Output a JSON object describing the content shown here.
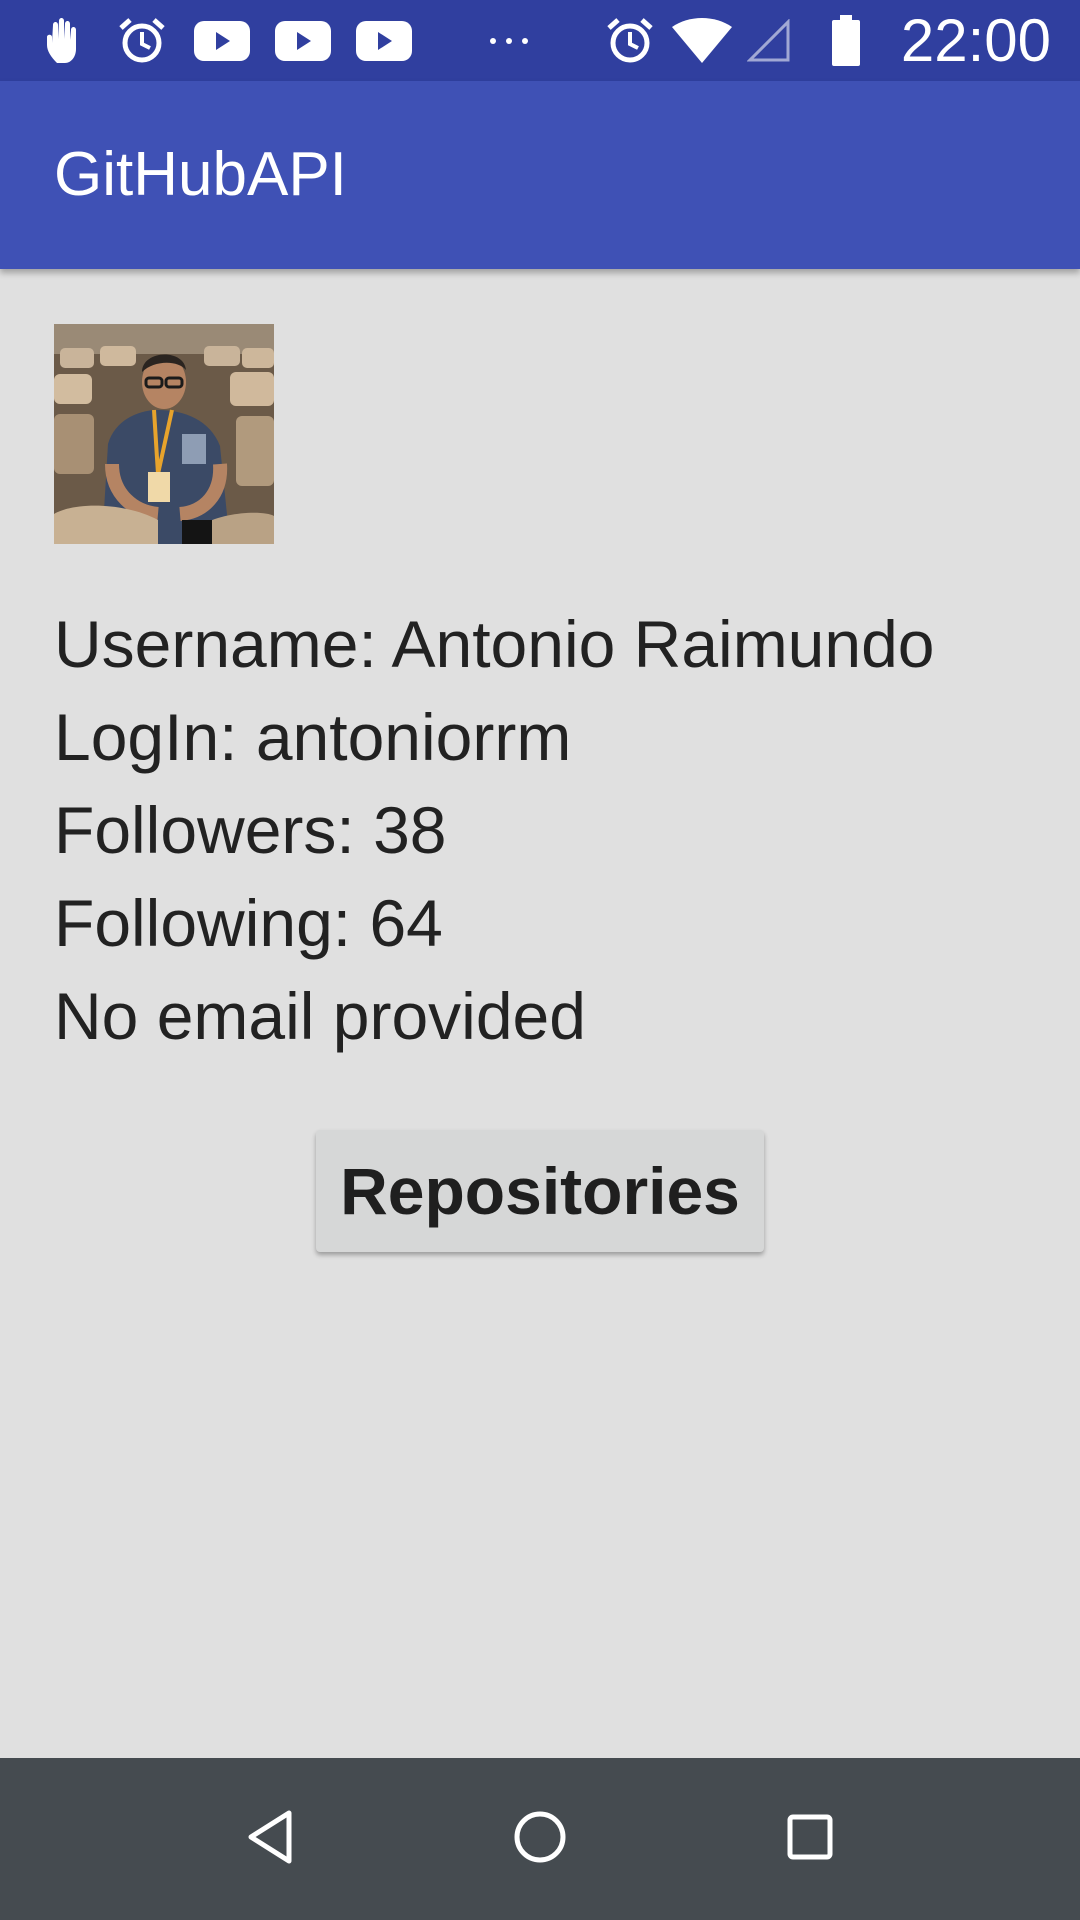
{
  "status_bar": {
    "time": "22:00",
    "icons_left": [
      "hand-touch-icon",
      "alarm-icon",
      "youtube-icon",
      "youtube-icon",
      "youtube-icon",
      "more-dots-icon"
    ],
    "icons_right": [
      "alarm-icon",
      "wifi-icon",
      "cell-signal-icon",
      "battery-icon"
    ]
  },
  "app_bar": {
    "title": "GitHubAPI"
  },
  "profile": {
    "username_line": "Username: Antonio Raimundo",
    "login_line": "LogIn: antoniorrm",
    "followers_line": "Followers: 38",
    "following_line": "Following: 64",
    "email_line": "No email provided"
  },
  "actions": {
    "repositories_label": "Repositories"
  },
  "nav_bar": {
    "icons": [
      "back-icon",
      "home-icon",
      "recents-icon"
    ]
  },
  "colors": {
    "status_bar": "#303f9f",
    "app_bar": "#3f51b5",
    "background": "#e0e0e0",
    "button": "#d6d7d7",
    "nav_bar": "#454b50"
  }
}
